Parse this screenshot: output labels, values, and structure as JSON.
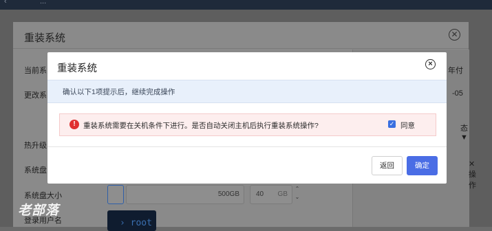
{
  "topbar": {
    "back_icon": "‹",
    "crumb": "..."
  },
  "background_dialog": {
    "title": "重装系统",
    "labels": [
      "当前系",
      "更改系",
      "热升级",
      "系统盘",
      "系统盘大小",
      "登录用户名"
    ],
    "right_texts": [
      "年付",
      "-05",
      "态 ▼",
      "✕ 操作"
    ],
    "disk_size_value": "500GB",
    "disk_count_value": "40",
    "disk_unit": "GB",
    "terminal_text": "› root"
  },
  "watermark": "老部落",
  "dialog": {
    "title": "重装系统",
    "info": "确认以下1项提示后，继续完成操作",
    "warning": "重装系统需要在关机条件下进行。是否自动关闭主机后执行重装系统操作?",
    "agree_label": "同意",
    "agree_checked": true,
    "back_label": "返回",
    "confirm_label": "确定"
  },
  "colors": {
    "primary": "#4a6de5",
    "warning": "#e02f2f",
    "info_bg": "#e8f0fb",
    "warn_bg": "#fdeeee"
  }
}
